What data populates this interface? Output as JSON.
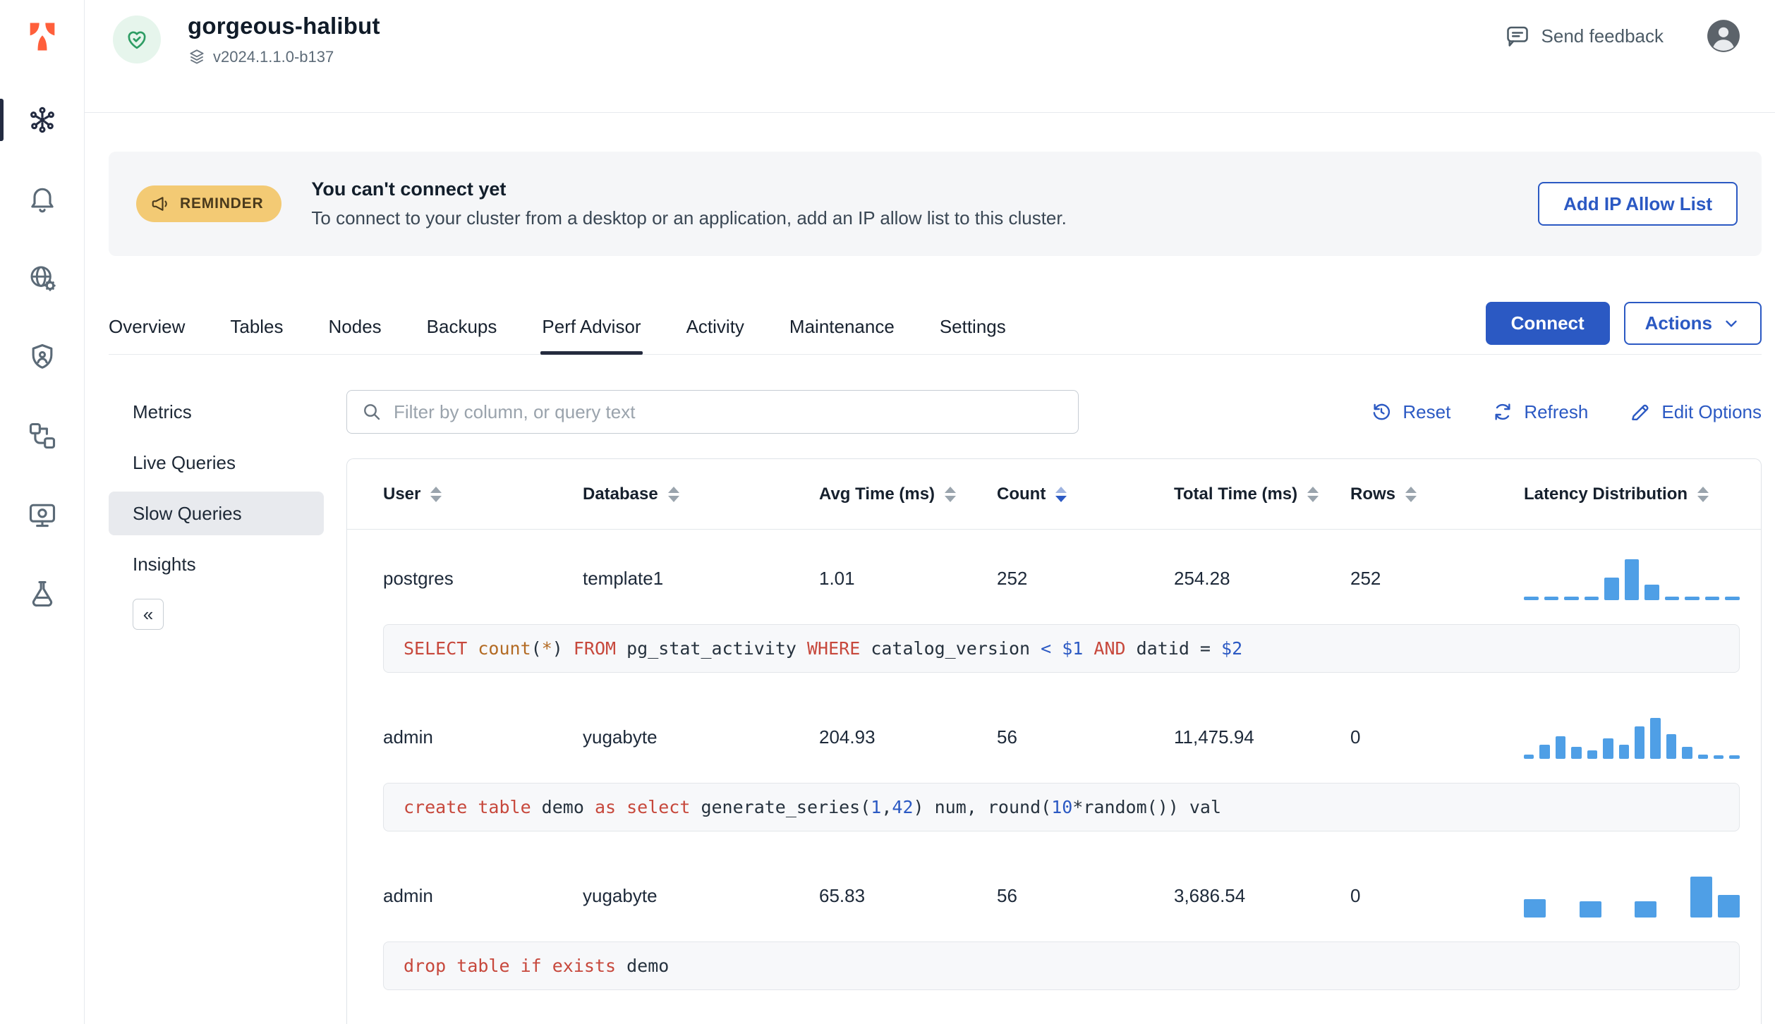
{
  "colors": {
    "primary": "#2b59c3",
    "bar": "#4f9fe6",
    "kw": "#c7483c",
    "fn": "#b36b24",
    "num": "#2b59c3"
  },
  "header": {
    "cluster_name": "gorgeous-halibut",
    "version": "v2024.1.1.0-b137",
    "send_feedback": "Send feedback"
  },
  "banner": {
    "badge": "REMINDER",
    "title": "You can't connect yet",
    "subtitle": "To connect to your cluster from a desktop or an application, add an IP allow list to this cluster.",
    "action": "Add IP Allow List"
  },
  "tabs": {
    "items": [
      "Overview",
      "Tables",
      "Nodes",
      "Backups",
      "Perf Advisor",
      "Activity",
      "Maintenance",
      "Settings"
    ],
    "active": "Perf Advisor",
    "connect_label": "Connect",
    "actions_label": "Actions"
  },
  "subnav": {
    "items": [
      "Metrics",
      "Live Queries",
      "Slow Queries",
      "Insights"
    ],
    "active": "Slow Queries",
    "collapse_glyph": "«"
  },
  "toolbar": {
    "filter_placeholder": "Filter by column, or query text",
    "reset_label": "Reset",
    "refresh_label": "Refresh",
    "edit_options_label": "Edit Options"
  },
  "table": {
    "columns": [
      "User",
      "Database",
      "Avg Time (ms)",
      "Count",
      "Total Time (ms)",
      "Rows",
      "Latency Distribution"
    ],
    "sorted_by": "Count",
    "rows": [
      {
        "user": "postgres",
        "database": "template1",
        "avg_time": "1.01",
        "count": "252",
        "total_time": "254.28",
        "rows": "252",
        "histogram": [
          0.05,
          0.05,
          0.05,
          0.05,
          0.55,
          1.0,
          0.38,
          0.05,
          0.05,
          0.05,
          0.05
        ],
        "sql": [
          {
            "t": "SELECT ",
            "c": "kw"
          },
          {
            "t": "count",
            "c": "fn"
          },
          {
            "t": "(",
            "c": "plain"
          },
          {
            "t": "*",
            "c": "fn"
          },
          {
            "t": ") ",
            "c": "plain"
          },
          {
            "t": "FROM ",
            "c": "kw"
          },
          {
            "t": "pg_stat_activity ",
            "c": "plain"
          },
          {
            "t": "WHERE ",
            "c": "kw"
          },
          {
            "t": "catalog_version ",
            "c": "plain"
          },
          {
            "t": "< ",
            "c": "op"
          },
          {
            "t": "$1 ",
            "c": "num"
          },
          {
            "t": "AND ",
            "c": "kw"
          },
          {
            "t": "datid = ",
            "c": "plain"
          },
          {
            "t": "$2",
            "c": "num"
          }
        ]
      },
      {
        "user": "admin",
        "database": "yugabyte",
        "avg_time": "204.93",
        "count": "56",
        "total_time": "11,475.94",
        "rows": "0",
        "histogram": [
          0.1,
          0.35,
          0.55,
          0.3,
          0.2,
          0.5,
          0.35,
          0.8,
          1.0,
          0.6,
          0.3,
          0.1,
          0.05,
          0.05
        ],
        "sql": [
          {
            "t": "create ",
            "c": "kw"
          },
          {
            "t": "table ",
            "c": "kw"
          },
          {
            "t": "demo ",
            "c": "plain"
          },
          {
            "t": "as ",
            "c": "kw"
          },
          {
            "t": "select ",
            "c": "kw"
          },
          {
            "t": "generate_series(",
            "c": "plain"
          },
          {
            "t": "1",
            "c": "num"
          },
          {
            "t": ",",
            "c": "plain"
          },
          {
            "t": "42",
            "c": "num"
          },
          {
            "t": ") num, round(",
            "c": "plain"
          },
          {
            "t": "10",
            "c": "num"
          },
          {
            "t": "*random()) val",
            "c": "plain"
          }
        ]
      },
      {
        "user": "admin",
        "database": "yugabyte",
        "avg_time": "65.83",
        "count": "56",
        "total_time": "3,686.54",
        "rows": "0",
        "histogram": [
          0.45,
          0,
          0.4,
          0,
          0.4,
          0,
          1.0,
          0.55
        ],
        "sql": [
          {
            "t": "drop ",
            "c": "kw"
          },
          {
            "t": "table ",
            "c": "kw"
          },
          {
            "t": "if ",
            "c": "kw"
          },
          {
            "t": "exists ",
            "c": "kw"
          },
          {
            "t": "demo",
            "c": "plain"
          }
        ]
      }
    ]
  }
}
